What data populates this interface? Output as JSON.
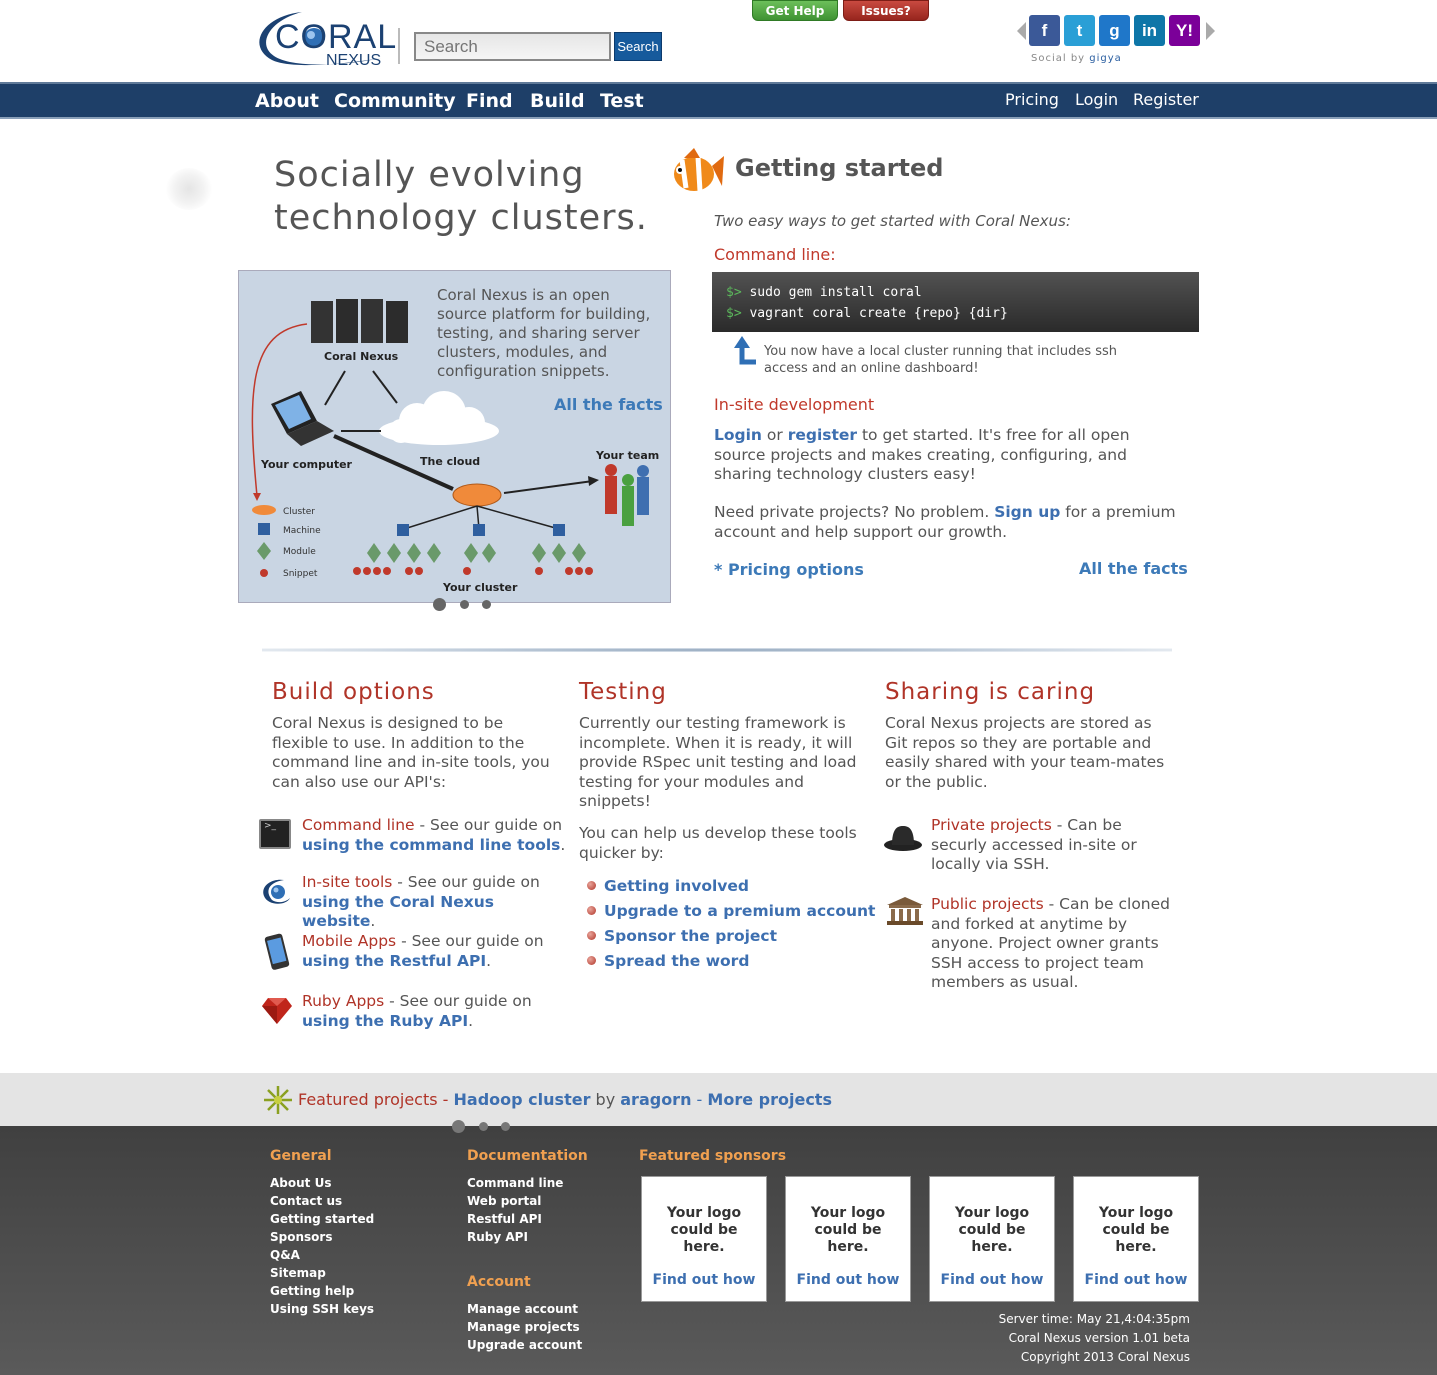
{
  "header": {
    "logo_main": "CORAL",
    "logo_sub": "NEXUS",
    "search_placeholder": "Search",
    "search_button": "Search",
    "get_help": "Get Help",
    "issues": "Issues?",
    "social_label": "Social by",
    "social_brand": "gigya",
    "social_icons": [
      "facebook-icon",
      "twitter-icon",
      "google-icon",
      "linkedin-icon",
      "yahoo-icon"
    ]
  },
  "nav": {
    "left": [
      "About",
      "Community",
      "Find",
      "Build",
      "Test"
    ],
    "right": [
      "Pricing",
      "Login",
      "Register"
    ]
  },
  "hero": {
    "title": "Socially evolving technology clusters.",
    "description": "Coral Nexus is an open source platform for building, testing, and sharing server clusters, modules, and configuration snippets.",
    "all_facts": "All the facts",
    "diagram": {
      "coral_nexus": "Coral Nexus",
      "your_computer": "Your computer",
      "the_cloud": "The cloud",
      "your_team": "Your team",
      "your_cluster": "Your cluster",
      "legend": [
        "Cluster",
        "Machine",
        "Module",
        "Snippet"
      ]
    }
  },
  "getting_started": {
    "title": "Getting started",
    "subtitle": "Two easy ways to get started with Coral Nexus:",
    "cmd_heading": "Command line:",
    "prompt": "$>",
    "cmd1": "sudo gem install coral",
    "cmd2": "vagrant coral create {repo} {dir}",
    "cmd_note": "You now have a local cluster running that includes ssh access and an online dashboard!",
    "insite_heading": "In-site development",
    "login": "Login",
    "or": " or ",
    "register": "register",
    "insite_text": " to get started. It's free for all open source projects and makes creating, configuring, and sharing technology clusters easy!",
    "private_pre": "Need private projects? No problem. ",
    "sign_up": "Sign up",
    "private_post": " for a premium account and help support our growth.",
    "pricing_options": "* Pricing options",
    "all_facts": "All the facts"
  },
  "build": {
    "title": "Build options",
    "intro": "Coral Nexus is designed to be flexible to use.  In addition to the command line and in-site tools, you can also use our API's:",
    "items": [
      {
        "name": "Command line",
        "mid": " - See our guide on ",
        "link": "using the command line tools",
        "end": "."
      },
      {
        "name": "In-site tools",
        "mid": " - See our guide on ",
        "link": "using the Coral Nexus website",
        "end": "."
      },
      {
        "name": "Mobile Apps",
        "mid": " - See our guide on ",
        "link": "using the Restful API",
        "end": "."
      },
      {
        "name": "Ruby Apps",
        "mid": " - See our guide on ",
        "link": "using the Ruby API",
        "end": "."
      }
    ]
  },
  "testing": {
    "title": "Testing",
    "intro": "Currently our testing framework is incomplete. When it is ready, it will provide RSpec unit testing and load testing for your modules and snippets!",
    "help": "You can help us develop these tools quicker by:",
    "items": [
      "Getting involved",
      "Upgrade to a premium account",
      "Sponsor the project",
      "Spread the word"
    ]
  },
  "sharing": {
    "title": "Sharing is caring",
    "intro": "Coral Nexus projects are stored as Git repos so they are portable and easily shared with your team-mates or the public.",
    "private_title": "Private projects",
    "private_text": " - Can be securly accessed in-site or locally via SSH.",
    "public_title": "Public projects",
    "public_text": " - Can be cloned and forked at anytime by anyone.  Project owner grants SSH access to project team members as usual."
  },
  "featured": {
    "label": "Featured projects -",
    "project": "Hadoop cluster",
    "by": " by ",
    "author": "aragorn",
    "sep": " - ",
    "more": "More projects"
  },
  "footer": {
    "general_title": "General",
    "general": [
      "About Us",
      "Contact us",
      "Getting started",
      "Sponsors",
      "Q&A",
      "Sitemap",
      "Getting help",
      "Using SSH keys"
    ],
    "doc_title": "Documentation",
    "docs": [
      "Command line",
      "Web portal",
      "Restful API",
      "Ruby API"
    ],
    "account_title": "Account",
    "account": [
      "Manage account",
      "Manage projects",
      "Upgrade account"
    ],
    "sponsors_title": "Featured sponsors",
    "sponsor_text": "Your logo could be here.",
    "sponsor_link": "Find out how",
    "server_time": "Server time: May 21,4:04:35pm",
    "version": "Coral Nexus version 1.01 beta",
    "copyright": "Copyright 2013 Coral Nexus"
  }
}
